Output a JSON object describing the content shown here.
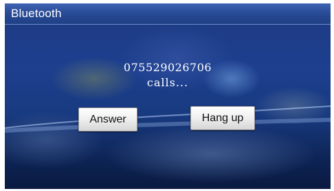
{
  "window": {
    "title": "Bluetooth"
  },
  "call": {
    "number": "075529026706",
    "status": "calls..."
  },
  "buttons": {
    "answer_label": "Answer",
    "hangup_label": "Hang up"
  }
}
